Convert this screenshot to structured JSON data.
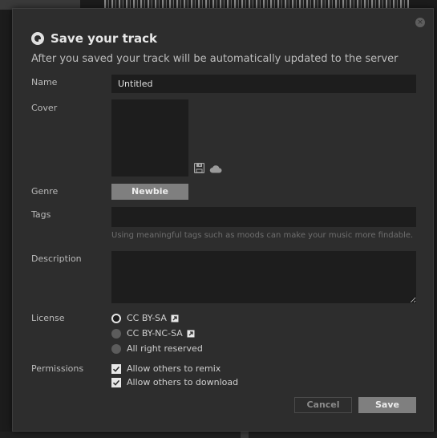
{
  "dialog": {
    "close_label": "×",
    "title": "Save your track",
    "subtitle": "After you saved your track will be automatically updated to the server"
  },
  "form": {
    "name_label": "Name",
    "name_value": "Untitled",
    "cover_label": "Cover",
    "genre_label": "Genre",
    "genre_value": "Newbie",
    "tags_label": "Tags",
    "tags_value": "",
    "tags_hint": "Using meaningful tags such as moods can make your music more findable.",
    "description_label": "Description",
    "description_value": "",
    "license_label": "License",
    "license_options": [
      {
        "label": "CC BY-SA",
        "selected": true,
        "external_link": true
      },
      {
        "label": "CC BY-NC-SA",
        "selected": false,
        "external_link": true
      },
      {
        "label": "All right reserved",
        "selected": false,
        "external_link": false
      }
    ],
    "permissions_label": "Permissions",
    "permissions": [
      {
        "label": "Allow others to remix",
        "checked": true
      },
      {
        "label": "Allow others to download",
        "checked": true
      }
    ]
  },
  "actions": {
    "cancel_label": "Cancel",
    "save_label": "Save"
  },
  "colors": {
    "dialog_bg": "#2d2d2d",
    "input_bg": "#1d1d1d",
    "button_bg": "#7f7f7f",
    "text": "#cfcfcf"
  },
  "icons": {
    "title": "record-icon",
    "cover_save": "floppy-disk-icon",
    "cover_upload": "cloud-icon",
    "license_link": "external-link-icon",
    "permission_check": "checkmark-icon"
  }
}
